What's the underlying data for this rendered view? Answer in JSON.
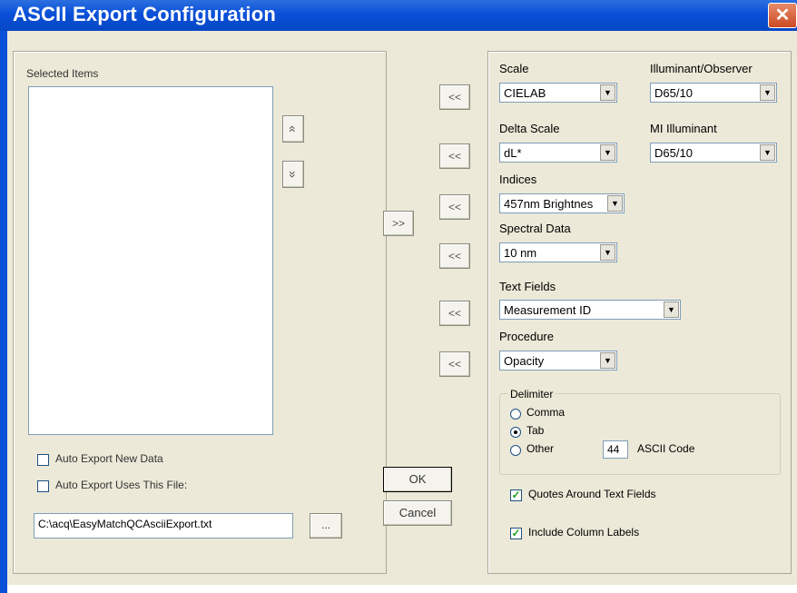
{
  "window": {
    "title": "ASCII Export Configuration",
    "close_glyph": "✕"
  },
  "left_panel": {
    "selected_items_label": "Selected Items",
    "move_up_glyph": "«",
    "move_down_glyph": "»",
    "auto_export_new_data": {
      "label": "Auto Export New Data",
      "checked": false
    },
    "auto_export_uses_file": {
      "label": "Auto Export Uses This File:",
      "checked": false
    },
    "file_path": "C:\\acq\\EasyMatchQCAsciiExport.txt",
    "browse_label": "..."
  },
  "middle": {
    "add_label": ">>",
    "remove_label": "<<",
    "ok_label": "OK",
    "cancel_label": "Cancel"
  },
  "right_panel": {
    "scale": {
      "label": "Scale",
      "value": "CIELAB"
    },
    "illuminant_observer": {
      "label": "Illuminant/Observer",
      "value": "D65/10"
    },
    "delta_scale": {
      "label": "Delta Scale",
      "value": "dL*"
    },
    "mi_illuminant": {
      "label": "MI Illuminant",
      "value": "D65/10"
    },
    "indices": {
      "label": "Indices",
      "value": "457nm Brightnes"
    },
    "spectral_data": {
      "label": "Spectral Data",
      "value": "10 nm"
    },
    "text_fields": {
      "label": "Text Fields",
      "value": "Measurement ID"
    },
    "procedure": {
      "label": "Procedure",
      "value": "Opacity"
    },
    "delimiter": {
      "label": "Delimiter",
      "options": [
        {
          "label": "Comma",
          "selected": false
        },
        {
          "label": "Tab",
          "selected": true
        },
        {
          "label": "Other",
          "selected": false
        }
      ],
      "ascii_code_value": "44",
      "ascii_code_label": "ASCII Code"
    },
    "quotes_around_text_fields": {
      "label": "Quotes Around Text Fields",
      "checked": true
    },
    "include_column_labels": {
      "label": "Include Column Labels",
      "checked": true
    }
  },
  "colors": {
    "title_bar": "#0a50d8",
    "dialog_bg": "#ece9d8",
    "close_button": "#d8572e"
  },
  "icons": {
    "dropdown": "chevron-down-icon",
    "check": "checkmark-icon"
  }
}
